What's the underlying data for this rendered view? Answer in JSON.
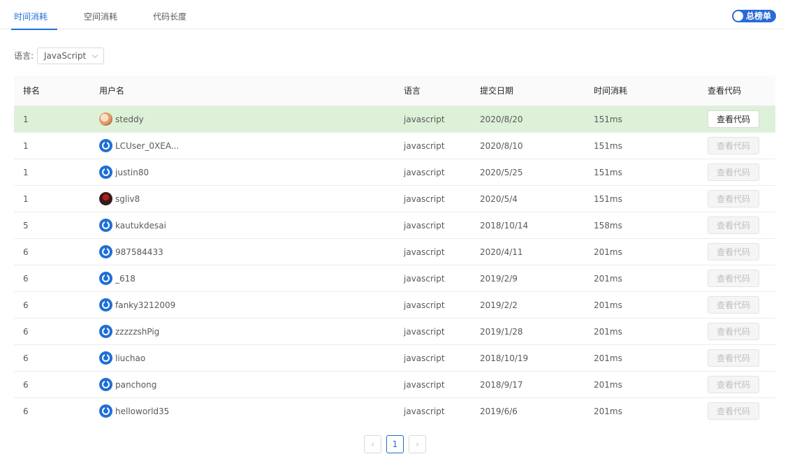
{
  "tabs": [
    {
      "label": "时间消耗",
      "active": true
    },
    {
      "label": "空间消耗",
      "active": false
    },
    {
      "label": "代码长度",
      "active": false
    }
  ],
  "toggle": {
    "label": "总榜单"
  },
  "filter": {
    "label": "语言:",
    "value": "JavaScript"
  },
  "table": {
    "headers": [
      "排名",
      "用户名",
      "语言",
      "提交日期",
      "时间消耗",
      "查看代码"
    ],
    "rows": [
      {
        "rank": "1",
        "user": "steddy",
        "avatar": "photo1",
        "lang": "javascript",
        "date": "2020/8/20",
        "time": "151ms",
        "action": "查看代码",
        "enabled": true
      },
      {
        "rank": "1",
        "user": "LCUser_0XEA...",
        "avatar": "default",
        "lang": "javascript",
        "date": "2020/8/10",
        "time": "151ms",
        "action": "查看代码",
        "enabled": false
      },
      {
        "rank": "1",
        "user": "justin80",
        "avatar": "default",
        "lang": "javascript",
        "date": "2020/5/25",
        "time": "151ms",
        "action": "查看代码",
        "enabled": false
      },
      {
        "rank": "1",
        "user": "sgliv8",
        "avatar": "photo2",
        "lang": "javascript",
        "date": "2020/5/4",
        "time": "151ms",
        "action": "查看代码",
        "enabled": false
      },
      {
        "rank": "5",
        "user": "kautukdesai",
        "avatar": "default",
        "lang": "javascript",
        "date": "2018/10/14",
        "time": "158ms",
        "action": "查看代码",
        "enabled": false
      },
      {
        "rank": "6",
        "user": "987584433",
        "avatar": "default",
        "lang": "javascript",
        "date": "2020/4/11",
        "time": "201ms",
        "action": "查看代码",
        "enabled": false
      },
      {
        "rank": "6",
        "user": "_618",
        "avatar": "default",
        "lang": "javascript",
        "date": "2019/2/9",
        "time": "201ms",
        "action": "查看代码",
        "enabled": false
      },
      {
        "rank": "6",
        "user": "fanky3212009",
        "avatar": "default",
        "lang": "javascript",
        "date": "2019/2/2",
        "time": "201ms",
        "action": "查看代码",
        "enabled": false
      },
      {
        "rank": "6",
        "user": "zzzzzshPig",
        "avatar": "default",
        "lang": "javascript",
        "date": "2019/1/28",
        "time": "201ms",
        "action": "查看代码",
        "enabled": false
      },
      {
        "rank": "6",
        "user": "liuchao",
        "avatar": "default",
        "lang": "javascript",
        "date": "2018/10/19",
        "time": "201ms",
        "action": "查看代码",
        "enabled": false
      },
      {
        "rank": "6",
        "user": "panchong",
        "avatar": "default",
        "lang": "javascript",
        "date": "2018/9/17",
        "time": "201ms",
        "action": "查看代码",
        "enabled": false
      },
      {
        "rank": "6",
        "user": "helloworld35",
        "avatar": "default",
        "lang": "javascript",
        "date": "2019/6/6",
        "time": "201ms",
        "action": "查看代码",
        "enabled": false
      }
    ]
  },
  "pagination": {
    "prev": "‹",
    "current": "1",
    "next": "›"
  },
  "colors": {
    "accent": "#1f6fd6",
    "highlight_row": "#ddf1d8"
  }
}
